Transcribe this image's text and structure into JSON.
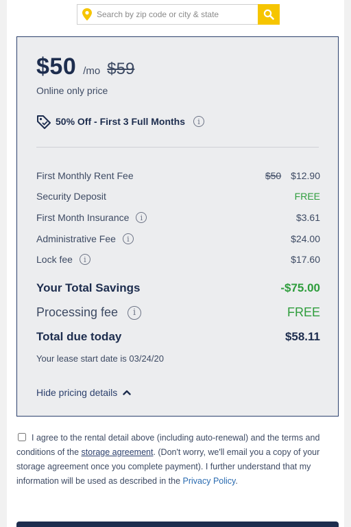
{
  "search": {
    "placeholder": "Search by zip code or city & state",
    "pin_icon": "map-pin-icon",
    "button_icon": "search-icon",
    "accent": "#f6c500"
  },
  "pricing": {
    "price": "$50",
    "per": "/mo",
    "old_price": "$59",
    "online_only": "Online only price",
    "promo": "50% Off - First 3 Full Months",
    "promo_icon": "price-tag-icon",
    "lines": [
      {
        "label": "First Monthly Rent Fee",
        "old": "$50",
        "value": "$12.90"
      },
      {
        "label": "Security Deposit",
        "value": "FREE"
      },
      {
        "label": "First Month Insurance",
        "value": "$3.61"
      },
      {
        "label": "Administrative Fee",
        "value": "$24.00"
      },
      {
        "label": "Lock fee",
        "value": "$17.60"
      }
    ],
    "savings_label": "Your Total Savings",
    "savings_value": "-$75.00",
    "processing_label": "Processing fee",
    "processing_value": "FREE",
    "total_label": "Total due today",
    "total_value": "$58.11",
    "lease_start": "Your lease start date is 03/24/20",
    "hide_details": "Hide pricing details",
    "info_glyph": "i",
    "colors": {
      "navy": "#1d2d4e",
      "green": "#2e9d3c",
      "border": "#2b3f6c",
      "card_bg": "#ecedef"
    }
  },
  "agreement": {
    "text_1": "I agree to the rental detail above (including auto-renewal) and the terms and conditions of the ",
    "storage_link": "storage agreement",
    "text_2": ". (Don't worry, we'll email you a copy of your storage agreement once you complete payment). I further understand that my information will be used as described in the ",
    "privacy_link": "Privacy Policy",
    "text_3": "."
  }
}
